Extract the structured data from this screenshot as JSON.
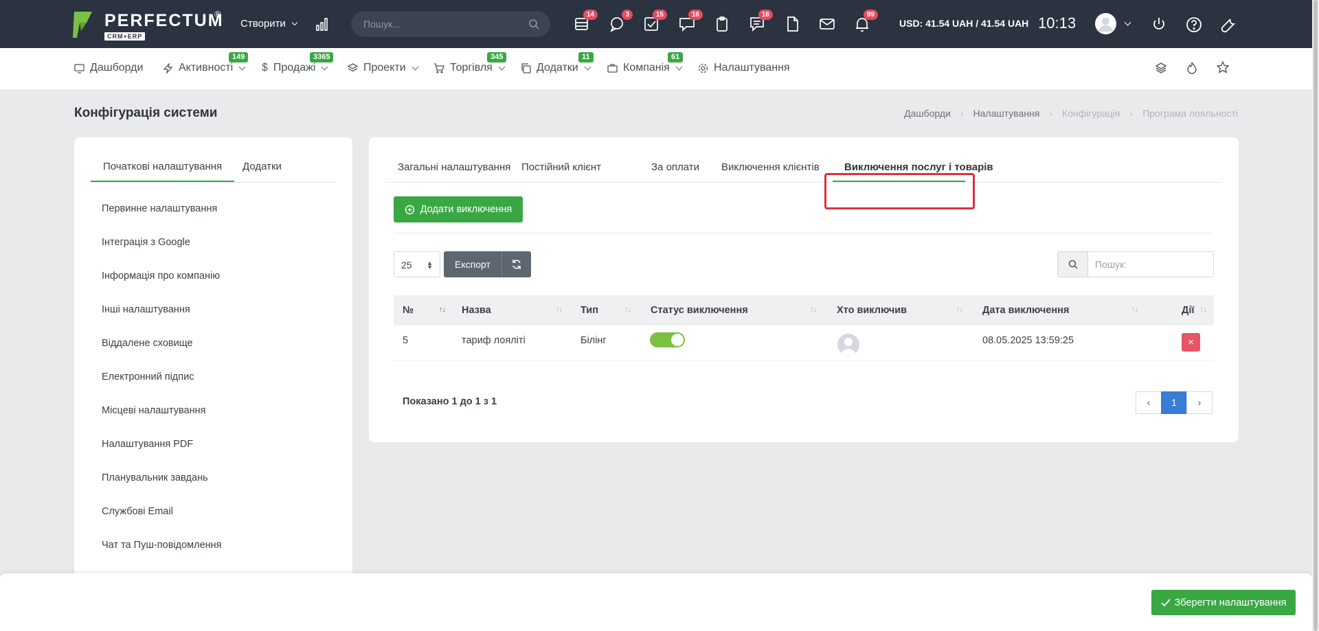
{
  "brand": {
    "name": "PERFECTUM",
    "reg": "®",
    "sub": "CRM+ERP"
  },
  "topbar": {
    "create_label": "Створити",
    "search_placeholder": "Пошук...",
    "badges": [
      "14",
      "3",
      "15",
      "16",
      "16",
      "99"
    ],
    "rate": "USD: 41.54 UAH / 41.54 UAH",
    "time": "10:13"
  },
  "nav": {
    "items": [
      {
        "label": "Дашборди"
      },
      {
        "label": "Активності",
        "badge": "149"
      },
      {
        "label": "Продажі",
        "badge": "3365"
      },
      {
        "label": "Проекти"
      },
      {
        "label": "Торгівля",
        "badge": "345"
      },
      {
        "label": "Додатки",
        "badge": "11"
      },
      {
        "label": "Компанія",
        "badge": "61"
      },
      {
        "label": "Налаштування"
      }
    ]
  },
  "page": {
    "title": "Конфігурація системи",
    "breadcrumb": [
      "Дашборди",
      "Налаштування",
      "Конфігурація",
      "Програма лояльності"
    ]
  },
  "sidebar": {
    "tabs": [
      "Початкові налаштування",
      "Додатки"
    ],
    "items": [
      "Первинне налаштування",
      "Інтеграція з Google",
      "Інформація про компанію",
      "Інші налаштування",
      "Віддалене сховище",
      "Електронний підпис",
      "Місцеві налаштування",
      "Налаштування PDF",
      "Планувальник завдань",
      "Службові Email",
      "Чат та Пуш-повідомлення"
    ]
  },
  "main": {
    "tabs": [
      "Загальні налаштування",
      "Постійний клієнт",
      "За оплати",
      "Виключення клієнтів",
      "Виключення послуг і товарів"
    ],
    "add_button": "Додати виключення",
    "page_size": "25",
    "export_label": "Експорт",
    "search_placeholder": "Пошук:",
    "columns": [
      "№",
      "Назва",
      "Тип",
      "Статус виключення",
      "Хто виключив",
      "Дата виключення",
      "Дії"
    ],
    "rows": [
      {
        "num": "5",
        "name": "тариф лояліті",
        "type": "Білінг",
        "status_on": true,
        "date": "08.05.2025 13:59:25"
      }
    ],
    "showing": "Показано 1 до 1 з 1",
    "pagination": {
      "prev": "‹",
      "current": "1",
      "next": "›"
    }
  },
  "footer": {
    "save_label": "Зберегти налаштування"
  },
  "colors": {
    "accent": "#39a843",
    "topbar": "#2b3340",
    "danger": "#e85466",
    "highlight": "#d8323e",
    "page_active": "#3a7dd6"
  }
}
